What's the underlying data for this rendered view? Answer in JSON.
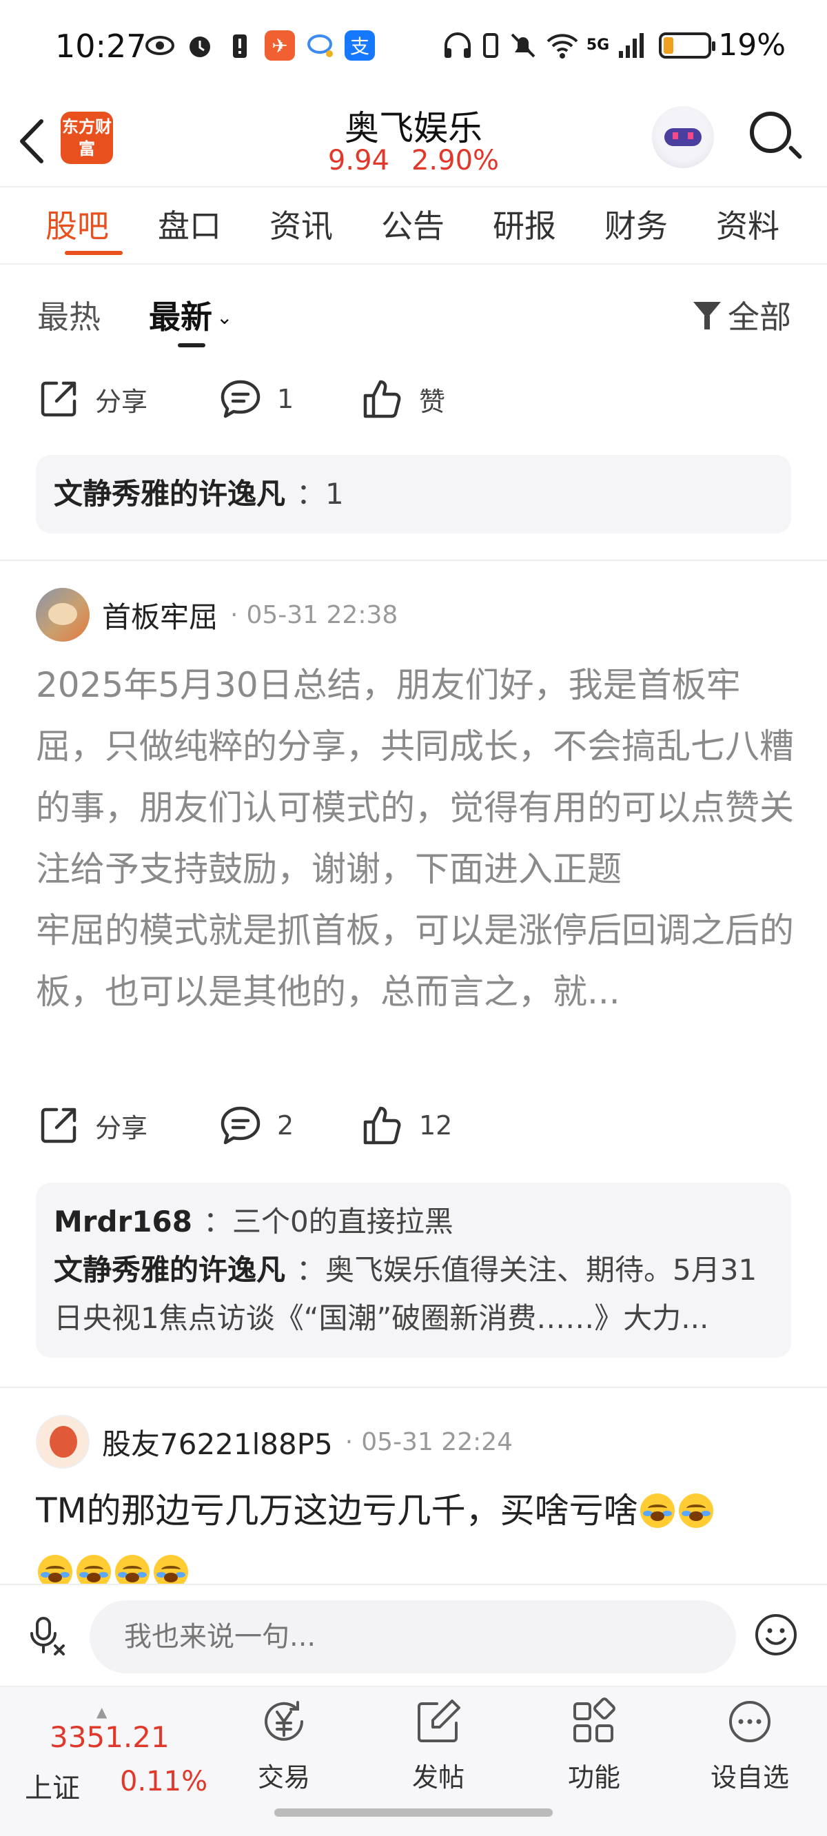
{
  "status_bar": {
    "time": "10:27",
    "network": "5G",
    "battery": "19%"
  },
  "header": {
    "logo_text": "东方财富",
    "title": "奥飞娱乐",
    "price": "9.94",
    "change_pct": "2.90%",
    "price_color": "#e0392b"
  },
  "tabs": [
    {
      "label": "股吧",
      "active": true
    },
    {
      "label": "盘口"
    },
    {
      "label": "资讯"
    },
    {
      "label": "公告"
    },
    {
      "label": "研报"
    },
    {
      "label": "财务"
    },
    {
      "label": "资料"
    }
  ],
  "sort": {
    "hot": "最热",
    "new": "最新",
    "filter": "全部"
  },
  "first_post_actions": {
    "share": "分享",
    "comments": "1",
    "like": "赞"
  },
  "first_post_replies": [
    {
      "name": "文静秀雅的许逸凡",
      "text": "：1"
    }
  ],
  "post1": {
    "author": "首板牢屈",
    "time": "05-31 22:38",
    "paragraph1": "2025年5月30日总结，朋友们好，我是首板牢屈，只做纯粹的分享，共同成长，不会搞乱七八糟的事，朋友们认可模式的，觉得有用的可以点赞关注给予支持鼓励，谢谢，下面进入正题",
    "paragraph2": "牢屈的模式就是抓首板，可以是涨停后回调之后的板，也可以是其他的，总而言之，就...",
    "share": "分享",
    "comments": "2",
    "likes": "12",
    "replies": [
      {
        "name": "Mrdr168",
        "text": "：三个0的直接拉黑"
      },
      {
        "name": "文静秀雅的许逸凡",
        "text": "：奥飞娱乐值得关注、期待。5月31日央视1焦点访谈《“国潮”破圈新消费……》大力..."
      }
    ]
  },
  "post2": {
    "author": "股友76221l88P5",
    "time": "05-31 22:24",
    "text": "TM的那边亏几万这边亏几千，买啥亏啥"
  },
  "comment_bar": {
    "placeholder": "我也来说一句..."
  },
  "bottom_nav": {
    "index_value": "3351.21",
    "index_name": "上证",
    "index_pct": "0.11%",
    "items": [
      {
        "label": "交易",
        "icon": "trade-yen-icon"
      },
      {
        "label": "发帖",
        "icon": "compose-icon"
      },
      {
        "label": "功能",
        "icon": "grid-icon"
      },
      {
        "label": "设自选",
        "icon": "more-icon"
      }
    ]
  },
  "accent_color": "#e8501e"
}
